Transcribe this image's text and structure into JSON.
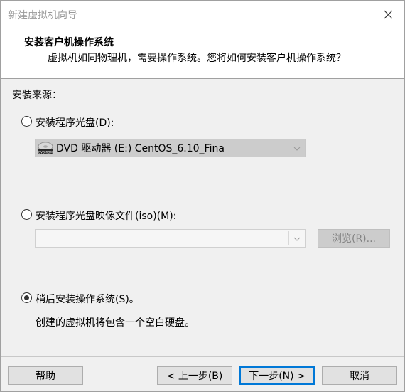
{
  "window": {
    "title": "新建虚拟机向导"
  },
  "header": {
    "title": "安装客户机操作系统",
    "subtitle": "虚拟机如同物理机，需要操作系统。您将如何安装客户机操作系统？"
  },
  "install_source": {
    "label": "安装来源：",
    "options": [
      {
        "label": "安装程序光盘(D):",
        "selected": false
      },
      {
        "label": "安装程序光盘映像文件(iso)(M):",
        "selected": false
      },
      {
        "label": "稍后安装操作系统(S)。",
        "selected": true
      }
    ],
    "disc_drive": {
      "value": "DVD 驱动器 (E:) CentOS_6.10_Fina",
      "icon": "dvd-drive-icon",
      "icon_text": "DVD-ROM"
    },
    "iso_path": {
      "value": ""
    },
    "browse_label": "浏览(R)...",
    "later_description": "创建的虚拟机将包含一个空白硬盘。"
  },
  "footer": {
    "help": "帮助",
    "back": "< 上一步(B)",
    "next": "下一步(N) >",
    "cancel": "取消"
  },
  "colors": {
    "dialog_bg": "#f0f0f0",
    "header_bg": "#ffffff",
    "disabled_text": "#838383"
  }
}
